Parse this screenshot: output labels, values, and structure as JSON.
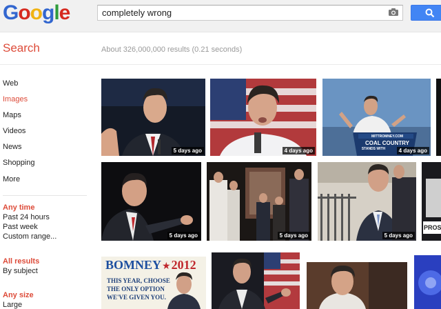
{
  "header": {
    "logo": "Google",
    "search_value": "completely wrong",
    "search_button_icon": "search-icon",
    "camera_icon": "camera-icon"
  },
  "results": {
    "search_label": "Search",
    "stats": "About 326,000,000 results (0.21 seconds)"
  },
  "sidebar": {
    "items": [
      {
        "label": "Web"
      },
      {
        "label": "Images"
      },
      {
        "label": "Maps"
      },
      {
        "label": "Videos"
      },
      {
        "label": "News"
      },
      {
        "label": "Shopping"
      },
      {
        "label": "More"
      }
    ],
    "time_filter": {
      "heading": "Any time",
      "options": [
        "Past 24 hours",
        "Past week",
        "Custom range..."
      ]
    },
    "results_filter": {
      "heading": "All results",
      "options": [
        "By subject"
      ]
    },
    "size_filter": {
      "heading": "Any size",
      "options": [
        "Large"
      ]
    }
  },
  "images": [
    {
      "age": "5 days ago"
    },
    {
      "age": "4 days ago"
    },
    {
      "age": "4 days ago",
      "podium_sign": "COAL COUNTRY",
      "podium_sub": "STANDS WITH",
      "podium_url": "MITTROMNEY.COM"
    },
    {
      "age": "5 days ago"
    },
    {
      "age": "5 days ago"
    },
    {
      "age": "5 days ago"
    },
    {
      "age": "",
      "edge_text": "PROS"
    },
    {
      "age": "",
      "poster_title": "BOMNEY",
      "poster_star": "★",
      "poster_year": "2012",
      "poster_line1": "THIS YEAR, CHOOSE",
      "poster_line2": "THE ONLY OPTION",
      "poster_line3": "WE'VE GIVEN YOU."
    },
    {
      "age": ""
    },
    {
      "age": ""
    },
    {
      "age": ""
    }
  ],
  "colors": {
    "accent_red": "#dd4b39",
    "search_blue": "#4285f4",
    "stats_gray": "#999999"
  }
}
